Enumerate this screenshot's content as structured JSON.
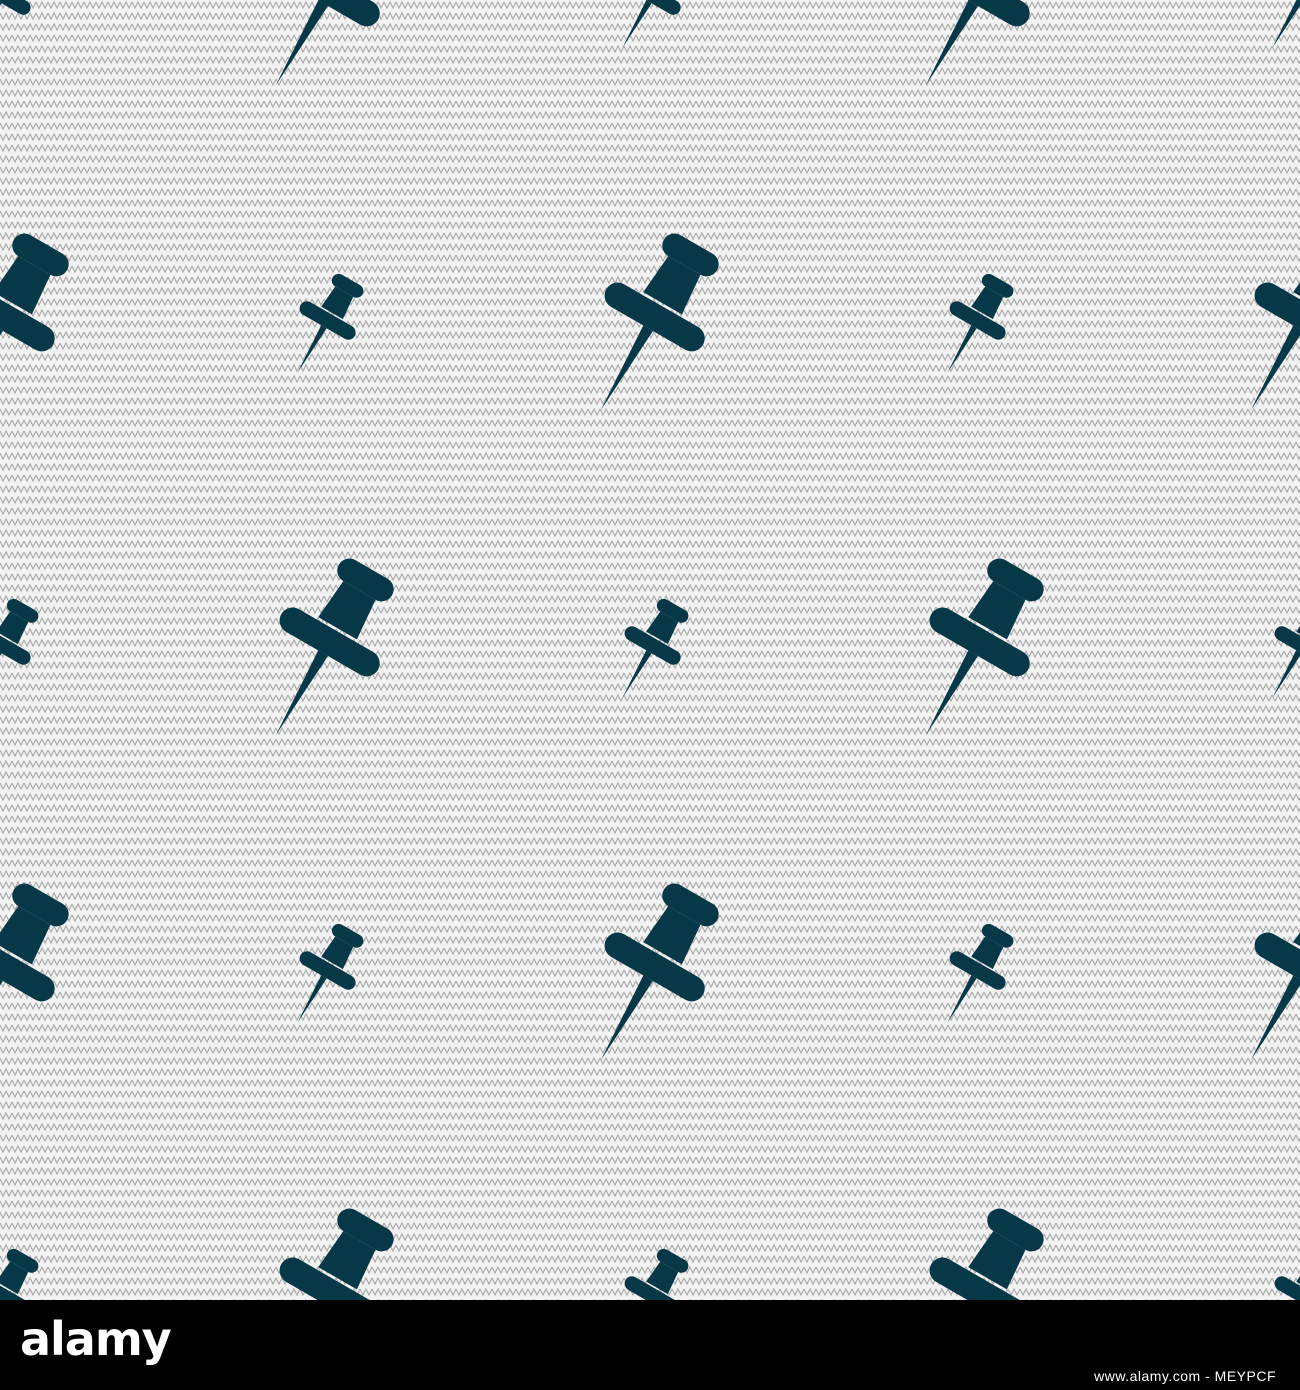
{
  "pattern": {
    "background_color": "#f2f2f2",
    "zigzag_color": "#a8a8a8",
    "icon_color": "#073848",
    "icon_name": "pushpin-icon"
  },
  "footer": {
    "brand": "alamy",
    "image_id": "www.alamy.com - MEYPCF",
    "background_color": "#000000"
  }
}
